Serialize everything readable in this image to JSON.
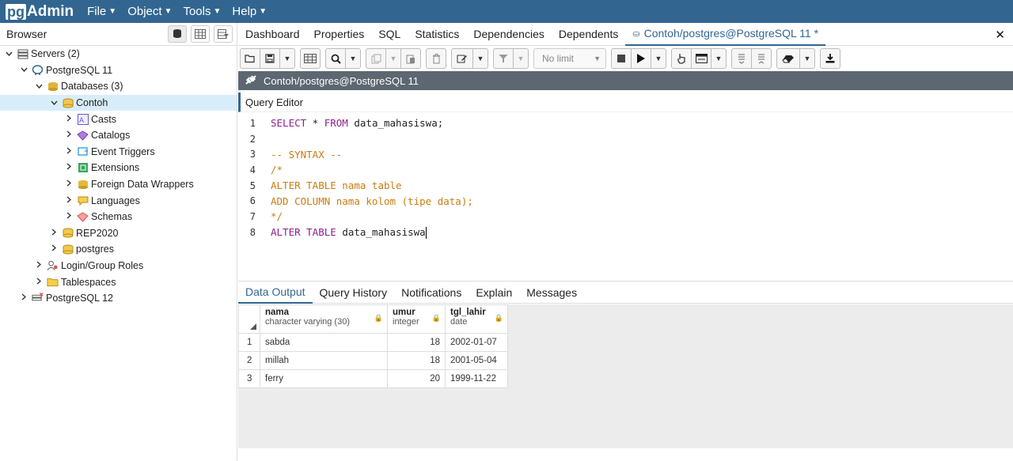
{
  "app": {
    "logo_pg": "pg",
    "logo_admin": "Admin"
  },
  "menu": [
    {
      "label": "File"
    },
    {
      "label": "Object"
    },
    {
      "label": "Tools"
    },
    {
      "label": "Help"
    }
  ],
  "browser": {
    "title": "Browser",
    "tree": [
      {
        "label": "Servers (2)",
        "level": 0,
        "expanded": true,
        "icon": "servers-icon"
      },
      {
        "label": "PostgreSQL 11",
        "level": 1,
        "expanded": true,
        "icon": "elephant-icon"
      },
      {
        "label": "Databases (3)",
        "level": 2,
        "expanded": true,
        "icon": "databases-icon"
      },
      {
        "label": "Contoh",
        "level": 3,
        "expanded": true,
        "icon": "database-icon",
        "selected": true
      },
      {
        "label": "Casts",
        "level": 4,
        "expanded": false,
        "icon": "casts-icon"
      },
      {
        "label": "Catalogs",
        "level": 4,
        "expanded": false,
        "icon": "catalogs-icon"
      },
      {
        "label": "Event Triggers",
        "level": 4,
        "expanded": false,
        "icon": "event-triggers-icon"
      },
      {
        "label": "Extensions",
        "level": 4,
        "expanded": false,
        "icon": "extensions-icon"
      },
      {
        "label": "Foreign Data Wrappers",
        "level": 4,
        "expanded": false,
        "icon": "foreign-data-wrappers-icon"
      },
      {
        "label": "Languages",
        "level": 4,
        "expanded": false,
        "icon": "languages-icon"
      },
      {
        "label": "Schemas",
        "level": 4,
        "expanded": false,
        "icon": "schemas-icon"
      },
      {
        "label": "REP2020",
        "level": 3,
        "expanded": false,
        "icon": "database-icon"
      },
      {
        "label": "postgres",
        "level": 3,
        "expanded": false,
        "icon": "database-icon"
      },
      {
        "label": "Login/Group Roles",
        "level": 2,
        "expanded": false,
        "icon": "roles-icon"
      },
      {
        "label": "Tablespaces",
        "level": 2,
        "expanded": false,
        "icon": "tablespaces-icon"
      },
      {
        "label": "PostgreSQL 12",
        "level": 1,
        "expanded": false,
        "icon": "server-disconnected-icon"
      }
    ]
  },
  "tabs": [
    {
      "label": "Dashboard"
    },
    {
      "label": "Properties"
    },
    {
      "label": "SQL"
    },
    {
      "label": "Statistics"
    },
    {
      "label": "Dependencies"
    },
    {
      "label": "Dependents"
    },
    {
      "label": "Contoh/postgres@PostgreSQL 11 *",
      "active": true
    }
  ],
  "toolbar": {
    "limit_placeholder": "No limit"
  },
  "connection": {
    "label": "Contoh/postgres@PostgreSQL 11"
  },
  "query_editor": {
    "title": "Query Editor",
    "lines": [
      {
        "n": "1",
        "segments": [
          {
            "t": "SELECT",
            "c": "kw"
          },
          {
            "t": " * ",
            "c": "tx"
          },
          {
            "t": "FROM",
            "c": "kw"
          },
          {
            "t": " data_mahasiswa;",
            "c": "tx"
          }
        ]
      },
      {
        "n": "2",
        "segments": []
      },
      {
        "n": "3",
        "segments": [
          {
            "t": "-- SYNTAX --",
            "c": "cm"
          }
        ]
      },
      {
        "n": "4",
        "segments": [
          {
            "t": "/*",
            "c": "cm"
          }
        ]
      },
      {
        "n": "5",
        "segments": [
          {
            "t": "ALTER TABLE nama table",
            "c": "cm"
          }
        ]
      },
      {
        "n": "6",
        "segments": [
          {
            "t": "ADD COLUMN nama kolom (tipe data);",
            "c": "cm"
          }
        ]
      },
      {
        "n": "7",
        "segments": [
          {
            "t": "*/",
            "c": "cm"
          }
        ]
      },
      {
        "n": "8",
        "segments": [
          {
            "t": "ALTER TABLE",
            "c": "kw"
          },
          {
            "t": " data_mahasiswa",
            "c": "tx"
          }
        ],
        "cursor": true
      }
    ]
  },
  "result_tabs": [
    {
      "label": "Data Output",
      "active": true
    },
    {
      "label": "Query History"
    },
    {
      "label": "Notifications"
    },
    {
      "label": "Explain"
    },
    {
      "label": "Messages"
    }
  ],
  "data_output": {
    "columns": [
      {
        "name": "nama",
        "type": "character varying (30)"
      },
      {
        "name": "umur",
        "type": "integer"
      },
      {
        "name": "tgl_lahir",
        "type": "date"
      }
    ],
    "rows": [
      {
        "n": "1",
        "nama": "sabda",
        "umur": "18",
        "tgl_lahir": "2002-01-07"
      },
      {
        "n": "2",
        "nama": "millah",
        "umur": "18",
        "tgl_lahir": "2001-05-04"
      },
      {
        "n": "3",
        "nama": "ferry",
        "umur": "20",
        "tgl_lahir": "1999-11-22"
      }
    ]
  }
}
